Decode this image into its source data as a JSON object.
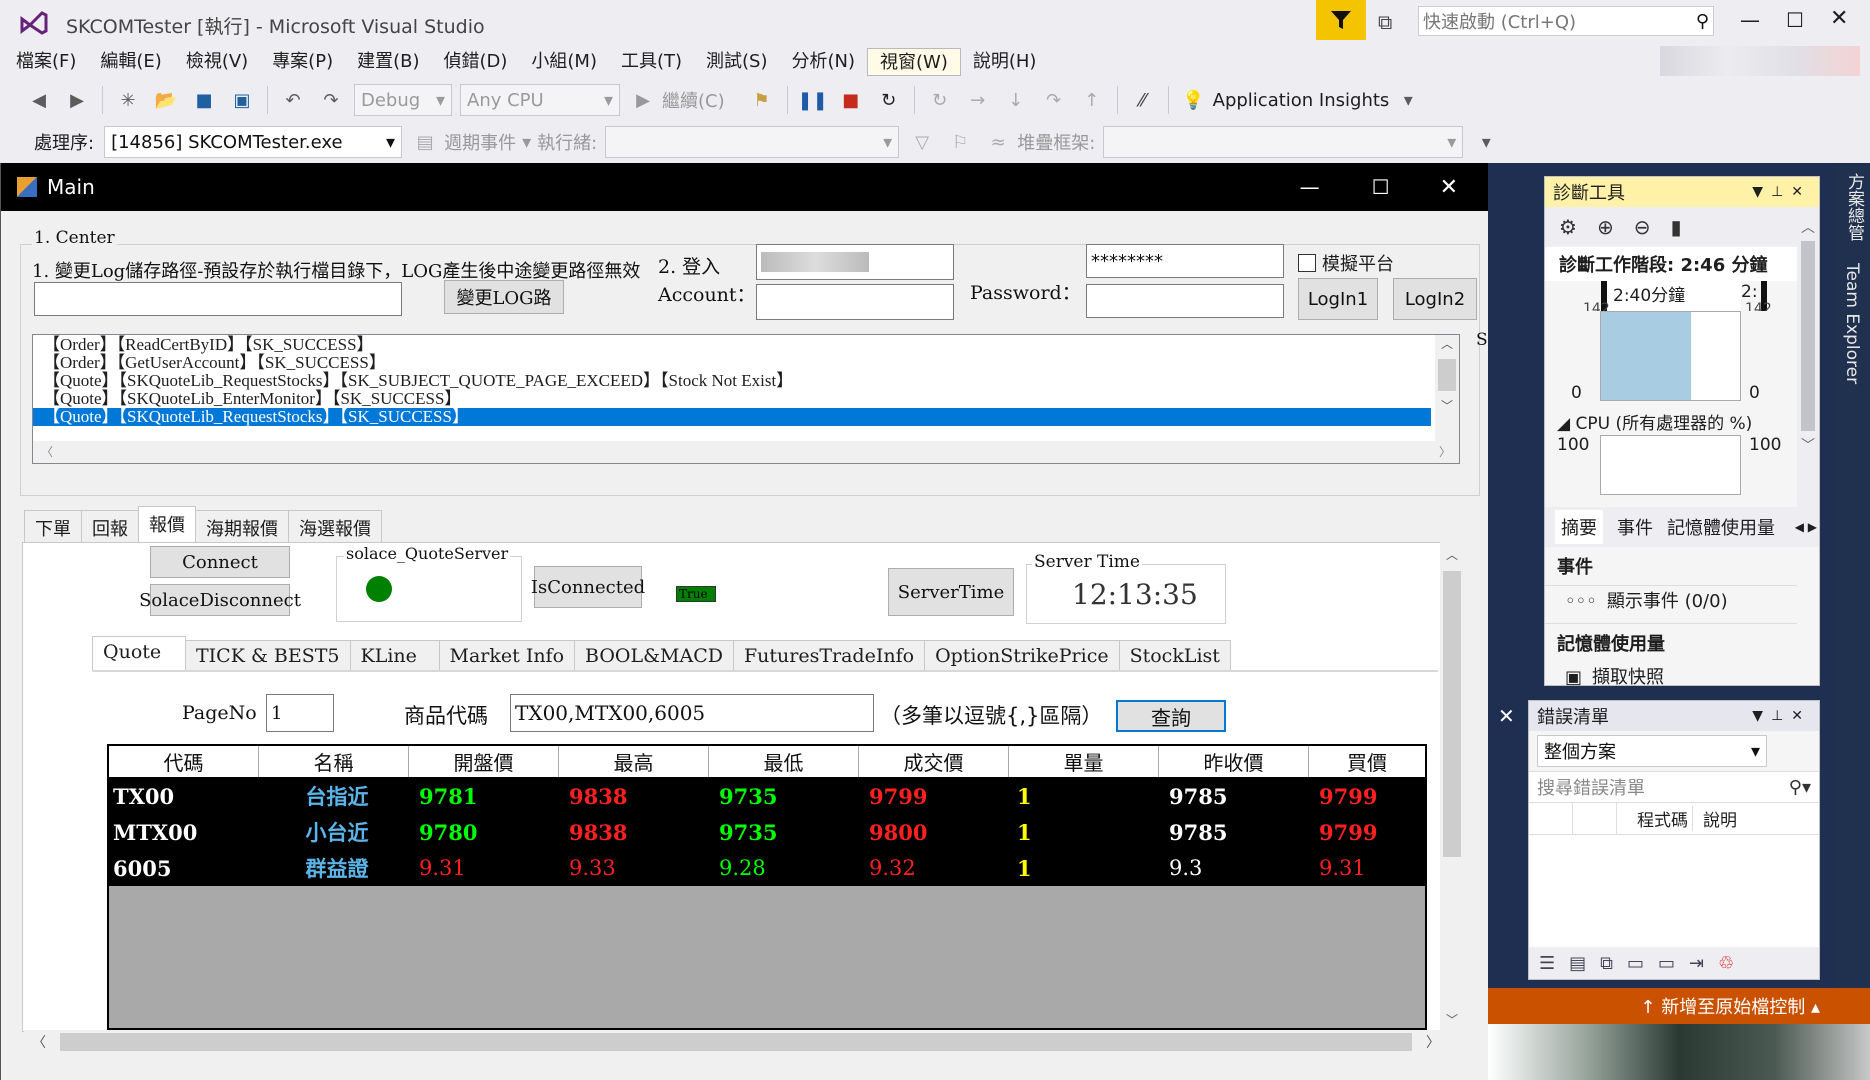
{
  "vs": {
    "title": "SKCOMTester [執行] - Microsoft Visual Studio",
    "quick_launch_placeholder": "快速啟動 (Ctrl+Q)",
    "menu": [
      "檔案(F)",
      "編輯(E)",
      "檢視(V)",
      "專案(P)",
      "建置(B)",
      "偵錯(D)",
      "小組(M)",
      "工具(T)",
      "測試(S)",
      "分析(N)",
      "視窗(W)",
      "說明(H)"
    ],
    "toolbar1": {
      "config": "Debug",
      "platform": "Any CPU",
      "continue": "繼續(C)",
      "app_insights": "Application Insights"
    },
    "toolbar2": {
      "process_label": "處理序:",
      "process": "[14856] SKCOMTester.exe",
      "lifecycle": "週期事件",
      "thread_label": "執行緒:",
      "stack_label": "堆疊框架:"
    }
  },
  "diag": {
    "title": "診斷工具",
    "session": "診斷工作階段: 2:46 分鐘",
    "timeline_label": "2:40分鐘",
    "timeline_label2": "2:",
    "axis_top_left": "142",
    "axis_top_right": "142",
    "zero_left": "0",
    "zero_right": "0",
    "cpu_label": "CPU (所有處理器的 %)",
    "cpu_100_left": "100",
    "cpu_100_right": "100",
    "tabs": [
      "摘要",
      "事件",
      "記憶體使用量"
    ],
    "events_header": "事件",
    "events_item": "顯示事件 (0/0)",
    "memory_header": "記憶體使用量",
    "snapshot": "擷取快照"
  },
  "errors": {
    "title": "錯誤清單",
    "scope": "整個方案",
    "search_placeholder": "搜尋錯誤清單",
    "col_code": "程式碼",
    "col_desc": "說明"
  },
  "side_tabs": [
    "方案總管",
    "Team Explorer"
  ],
  "source_control": "新增至原始檔控制",
  "main": {
    "title": "Main",
    "center_label": "1. Center",
    "log_path_label": "1. 變更Log儲存路徑-預設存於執行檔目錄下，LOG產生後中途變更路徑無效",
    "change_log_btn": "變更LOG路",
    "login_label": "2. 登入",
    "account_label": "Account：",
    "password_label": "Password：",
    "password_value": "********",
    "sim_label": "模擬平台",
    "login1": "LogIn1",
    "login2": "LogIn2",
    "side_letter": "S",
    "log_rows": [
      "【Order】【ReadCertByID】【SK_SUCCESS】",
      "【Order】【GetUserAccount】【SK_SUCCESS】",
      "【Quote】【SKQuoteLib_RequestStocks】【SK_SUBJECT_QUOTE_PAGE_EXCEED】【Stock Not Exist】",
      "【Quote】【SKQuoteLib_EnterMonitor】【SK_SUCCESS】",
      "【Quote】【SKQuoteLib_RequestStocks】【SK_SUCCESS】"
    ],
    "tabs": [
      "下單",
      "回報",
      "報價",
      "海期報價",
      "海選報價"
    ],
    "connect_btn": "Connect",
    "solace_disconnect_btn": "SolaceDisconnect",
    "solace_group": "solace_QuoteServer",
    "is_connected_btn": "IsConnected",
    "is_connected_value": "True",
    "server_time_btn": "ServerTime",
    "server_time_group": "Server Time",
    "server_time_value": "12:13:35",
    "quote_tabs": [
      "Quote",
      "TICK & BEST5",
      "KLine",
      "Market Info",
      "BOOL&MACD",
      "FuturesTradeInfo",
      "OptionStrikePrice",
      "StockList"
    ],
    "page_no_label": "PageNo",
    "page_no_value": "1",
    "product_label": "商品代碼",
    "product_value": "TX00,MTX00,6005",
    "product_hint": "（多筆以逗號{,}區隔）",
    "query_btn": "查詢",
    "columns": [
      "代碼",
      "名稱",
      "開盤價",
      "最高",
      "最低",
      "成交價",
      "單量",
      "昨收價",
      "買價"
    ],
    "rows": [
      {
        "code": "TX00",
        "name": "台指近",
        "open": "9781",
        "high": "9838",
        "low": "9735",
        "last": "9799",
        "qty": "1",
        "prev": "9785",
        "bid": "9799"
      },
      {
        "code": "MTX00",
        "name": "小台近",
        "open": "9780",
        "high": "9838",
        "low": "9735",
        "last": "9800",
        "qty": "1",
        "prev": "9785",
        "bid": "9799"
      },
      {
        "code": "6005",
        "name": "群益證",
        "open": "9.31",
        "high": "9.33",
        "low": "9.28",
        "last": "9.32",
        "qty": "1",
        "prev": "9.3",
        "bid": "9.31"
      }
    ]
  },
  "colors": {
    "accent": "#0078d7",
    "filter_yellow": "#f5c400",
    "orange_bar": "#ca5100",
    "led_green": "#008000",
    "diag_fill": "#a8cde2"
  }
}
